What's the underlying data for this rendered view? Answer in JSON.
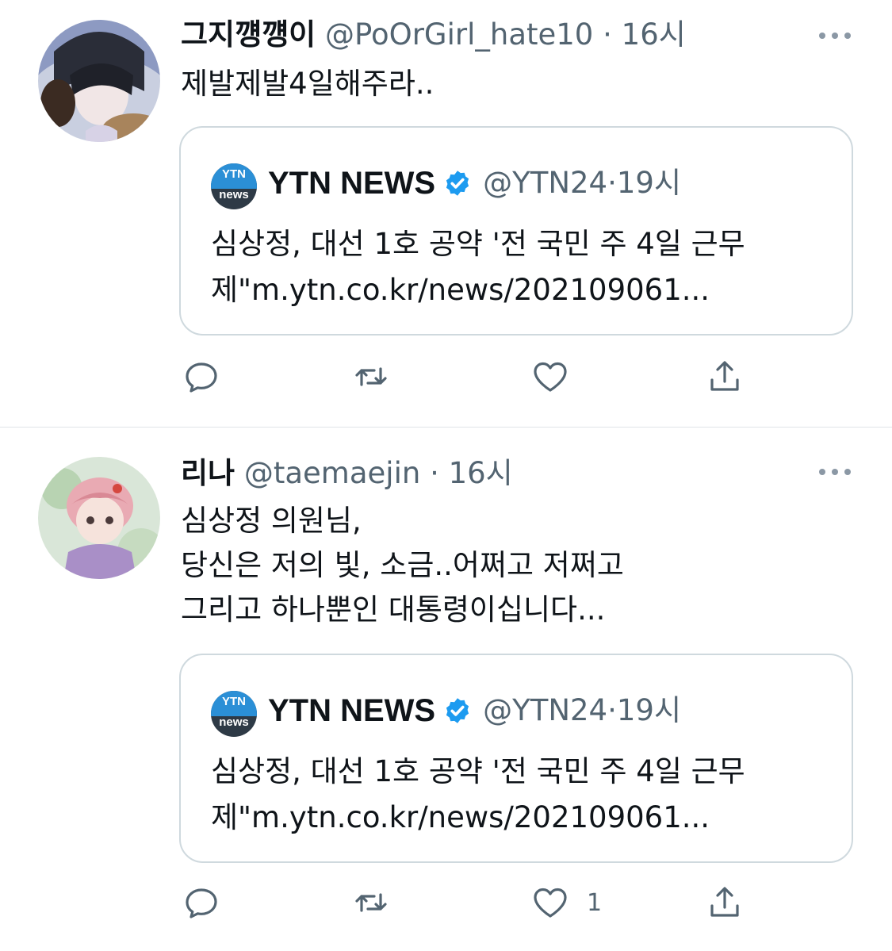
{
  "tweets": [
    {
      "author": {
        "display_name": "그지꺵꺵이",
        "handle": "@PoOrGirl_hate10",
        "time": "16시"
      },
      "separator": "·",
      "text": "제발제발4일해주라..",
      "quote": {
        "logo_text_top": "YTN",
        "logo_text_bottom": "news",
        "author": {
          "display_name": "YTN NEWS",
          "handle": "@YTN24",
          "time": "19시",
          "verified": true
        },
        "separator": "·",
        "text": "심상정, 대선 1호 공약 '전 국민 주 4일 근무제\"m.ytn.co.kr/news/202109061..."
      },
      "actions": {
        "reply_icon": "reply-icon",
        "retweet_icon": "retweet-icon",
        "like_icon": "heart-icon",
        "share_icon": "share-icon",
        "like_count": ""
      }
    },
    {
      "author": {
        "display_name": "리나",
        "handle": "@taemaejin",
        "time": "16시"
      },
      "separator": "·",
      "text": "심상정 의원님,\n당신은 저의 빛, 소금..어쩌고 저쩌고\n그리고 하나뿐인 대통령이십니다...",
      "quote": {
        "logo_text_top": "YTN",
        "logo_text_bottom": "news",
        "author": {
          "display_name": "YTN NEWS",
          "handle": "@YTN24",
          "time": "19시",
          "verified": true
        },
        "separator": "·",
        "text": "심상정, 대선 1호 공약 '전 국민 주 4일 근무제\"m.ytn.co.kr/news/202109061..."
      },
      "actions": {
        "reply_icon": "reply-icon",
        "retweet_icon": "retweet-icon",
        "like_icon": "heart-icon",
        "share_icon": "share-icon",
        "like_count": "1"
      }
    }
  ],
  "colors": {
    "text": "#0f1419",
    "secondary": "#536471",
    "border": "#cfd9de",
    "verified": "#1d9bf0",
    "ytn_blue": "#2b8fd6"
  }
}
